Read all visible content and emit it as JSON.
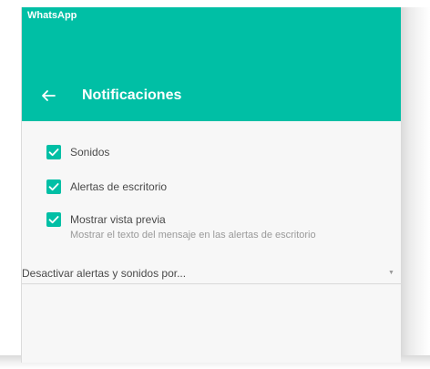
{
  "window": {
    "app_title": "WhatsApp"
  },
  "drawer": {
    "title": "Notificaciones",
    "back_icon": "arrow-left-icon"
  },
  "options": [
    {
      "label": "Sonidos",
      "checked": true
    },
    {
      "label": "Alertas de escritorio",
      "checked": true
    },
    {
      "label": "Mostrar vista previa",
      "sublabel": "Mostrar el texto del mensaje en las alertas de escritorio",
      "checked": true
    }
  ],
  "mute_select": {
    "value": "Desactivar alertas y sonidos por...",
    "arrow_icon": "caret-down-icon"
  },
  "colors": {
    "accent": "#00bfa5",
    "background": "#f7f7f7"
  }
}
